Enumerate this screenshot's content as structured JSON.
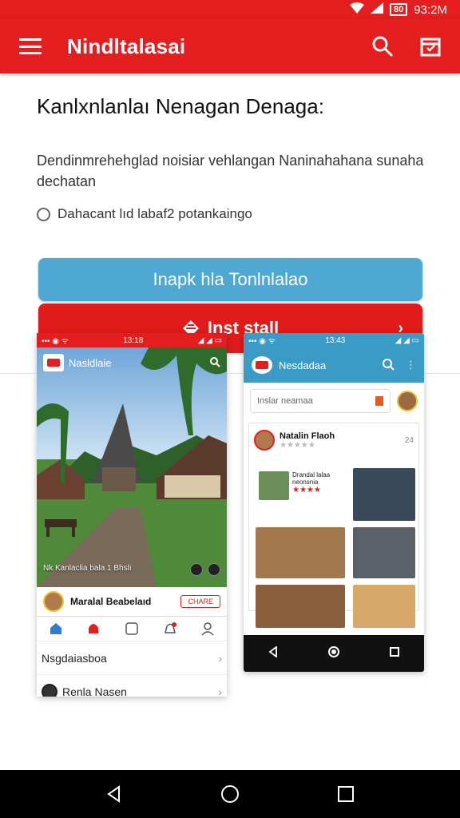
{
  "status_bar": {
    "time": "93:2M",
    "battery_label": "80"
  },
  "app_bar": {
    "title": "Nindltalasai"
  },
  "main": {
    "heading": "Kanlxnlanlaı Nenagan Denaga:",
    "description": "Dendinmrehehglad noisiar vehlangan Naninahahana sunaha dechatan",
    "radio_label": "Dahacant lıd labaf2 potankaingo",
    "primary_button": "Inapk hla Tonlnlalao",
    "install_button": "Inst stall"
  },
  "screenshot_left": {
    "status_time": "13:18",
    "app_title": "Nasldlaie",
    "caption": "Nk Kanlaclia bala 1 Bhslı",
    "user_name": "Maralal Beabelaıd",
    "user_button": "CHARE",
    "list_items": [
      "Nsgdaiasboa",
      "Renla Nasen"
    ]
  },
  "screenshot_right": {
    "status_time": "13:43",
    "app_title": "Nesdadaa",
    "search_placeholder": "Inslar neamaa",
    "user_name": "Natalin Flaoh",
    "count": "24",
    "tile_text": "Drandal lalaa neonsnia"
  },
  "colors": {
    "primary_red": "#e41e1e",
    "secondary_blue": "#4fa8d2",
    "preview_blue": "#3a9cc6"
  },
  "icons": [
    "menu-icon",
    "search-icon",
    "bookmark-icon",
    "shield-icon",
    "chevron-right-icon",
    "back-icon",
    "home-icon",
    "recents-icon"
  ]
}
